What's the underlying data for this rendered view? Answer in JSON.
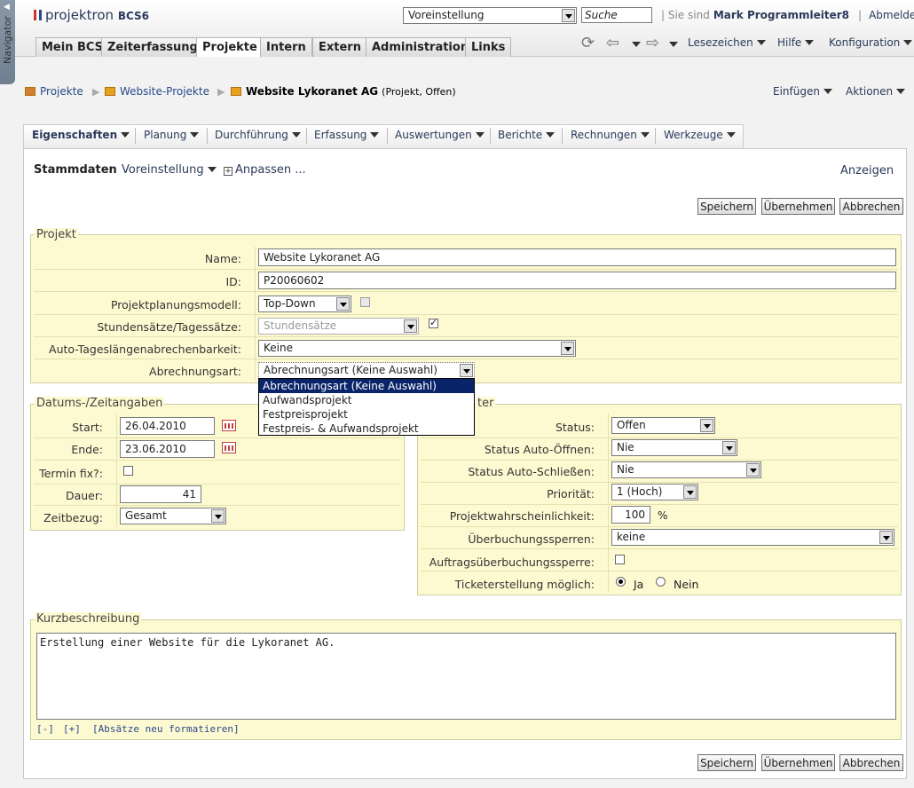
{
  "navigator": {
    "label": "Navigator"
  },
  "app": {
    "logo_text": "projektron",
    "logo_suffix": "BCS6"
  },
  "header": {
    "preset": "Voreinstellung",
    "search_value": "Suche",
    "user_prefix": "| Sie sind",
    "user_name": "Mark Programmleiter8",
    "logout": "Abmelden"
  },
  "main_tabs": [
    "Mein BCS",
    "Zeiterfassung",
    "Projekte",
    "Intern",
    "Extern",
    "Administration",
    "Links"
  ],
  "active_main_tab": "Projekte",
  "toolbar": {
    "bookmarks": "Lesezeichen",
    "help": "Hilfe",
    "config": "Konfiguration"
  },
  "breadcrumb": {
    "items": [
      "Projekte",
      "Website-Projekte"
    ],
    "current": "Website Lykoranet AG",
    "current_sub": "(Projekt, Offen)"
  },
  "actions": {
    "insert": "Einfügen",
    "actions": "Aktionen"
  },
  "sub_tabs": [
    "Eigenschaften",
    "Planung",
    "Durchführung",
    "Erfassung",
    "Auswertungen",
    "Berichte",
    "Rechnungen",
    "Werkzeuge"
  ],
  "viewbar": {
    "title": "Stammdaten",
    "preset": "Voreinstellung",
    "customize": "Anpassen ...",
    "show": "Anzeigen"
  },
  "buttons": {
    "save": "Speichern",
    "apply": "Übernehmen",
    "cancel": "Abbrechen"
  },
  "projekt": {
    "legend": "Projekt",
    "name_label": "Name:",
    "name_value": "Website Lykoranet AG",
    "id_label": "ID:",
    "id_value": "P20060602",
    "model_label": "Projektplanungsmodell:",
    "model_value": "Top-Down",
    "rates_label": "Stundensätze/Tagessätze:",
    "rates_value": "Stundensätze",
    "auto_label": "Auto-Tageslängenabrechenbarkeit:",
    "auto_value": "Keine",
    "billing_label": "Abrechnungsart:",
    "billing_value": "Abrechnungsart (Keine Auswahl)",
    "billing_options": [
      "Abrechnungsart (Keine Auswahl)",
      "Aufwandsprojekt",
      "Festpreisprojekt",
      "Festpreis- & Aufwandsprojekt"
    ]
  },
  "datum": {
    "legend": "Datums-/Zeitangaben",
    "start_label": "Start:",
    "start_value": "26.04.2010",
    "end_label": "Ende:",
    "end_value": "23.06.2010",
    "fix_label": "Termin fix?:",
    "duration_label": "Dauer:",
    "duration_value": "41",
    "ref_label": "Zeitbezug:",
    "ref_value": "Gesamt"
  },
  "params": {
    "legend_tail": "ter",
    "status_label": "Status:",
    "status_value": "Offen",
    "auto_open_label": "Status Auto-Öffnen:",
    "auto_open_value": "Nie",
    "auto_close_label": "Status Auto-Schließen:",
    "auto_close_value": "Nie",
    "priority_label": "Priorität:",
    "priority_value": "1 (Hoch)",
    "prob_label": "Projektwahrscheinlichkeit:",
    "prob_value": "100",
    "prob_unit": "%",
    "overbook_label": "Überbuchungssperren:",
    "overbook_value": "keine",
    "order_overbook_label": "Auftragsüberbuchungssperre:",
    "ticket_label": "Ticketerstellung möglich:",
    "ticket_yes": "Ja",
    "ticket_no": "Nein"
  },
  "kurz": {
    "legend": "Kurzbeschreibung",
    "text": "Erstellung einer Website für die Lykoranet AG.",
    "collapse": "[-]",
    "expand": "[+]",
    "reformat": "[Absätze neu formatieren]"
  }
}
